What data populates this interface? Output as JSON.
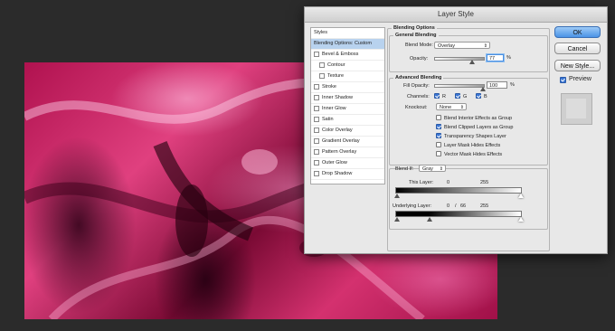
{
  "window": {
    "title": "Layer Style"
  },
  "styles_list": [
    {
      "label": "Styles",
      "checkbox": false,
      "selected": false,
      "sub": false
    },
    {
      "label": "Blending Options: Custom",
      "checkbox": false,
      "selected": true,
      "sub": false
    },
    {
      "label": "Bevel & Emboss",
      "checkbox": true,
      "selected": false,
      "sub": false
    },
    {
      "label": "Contour",
      "checkbox": true,
      "selected": false,
      "sub": true
    },
    {
      "label": "Texture",
      "checkbox": true,
      "selected": false,
      "sub": true
    },
    {
      "label": "Stroke",
      "checkbox": true,
      "selected": false,
      "sub": false
    },
    {
      "label": "Inner Shadow",
      "checkbox": true,
      "selected": false,
      "sub": false
    },
    {
      "label": "Inner Glow",
      "checkbox": true,
      "selected": false,
      "sub": false
    },
    {
      "label": "Satin",
      "checkbox": true,
      "selected": false,
      "sub": false
    },
    {
      "label": "Color Overlay",
      "checkbox": true,
      "selected": false,
      "sub": false
    },
    {
      "label": "Gradient Overlay",
      "checkbox": true,
      "selected": false,
      "sub": false
    },
    {
      "label": "Pattern Overlay",
      "checkbox": true,
      "selected": false,
      "sub": false
    },
    {
      "label": "Outer Glow",
      "checkbox": true,
      "selected": false,
      "sub": false
    },
    {
      "label": "Drop Shadow",
      "checkbox": true,
      "selected": false,
      "sub": false
    }
  ],
  "blending_options": {
    "title": "Blending Options",
    "general": {
      "title": "General Blending",
      "blend_mode_label": "Blend Mode:",
      "blend_mode_value": "Overlay",
      "opacity_label": "Opacity:",
      "opacity_value": "77",
      "opacity_unit": "%",
      "opacity_level": 0.77
    },
    "advanced": {
      "title": "Advanced Blending",
      "fill_opacity_label": "Fill Opacity:",
      "fill_opacity_value": "100",
      "fill_opacity_unit": "%",
      "fill_opacity_level": 1.0,
      "channels_label": "Channels:",
      "channels": [
        {
          "label": "R",
          "checked": true
        },
        {
          "label": "G",
          "checked": true
        },
        {
          "label": "B",
          "checked": true
        }
      ],
      "knockout_label": "Knockout:",
      "knockout_value": "None",
      "options": [
        {
          "label": "Blend Interior Effects as Group",
          "checked": false
        },
        {
          "label": "Blend Clipped Layers as Group",
          "checked": true
        },
        {
          "label": "Transparency Shapes Layer",
          "checked": true
        },
        {
          "label": "Layer Mask Hides Effects",
          "checked": false
        },
        {
          "label": "Vector Mask Hides Effects",
          "checked": false
        }
      ]
    },
    "blend_if": {
      "label": "Blend If:",
      "value": "Gray",
      "this_layer": {
        "label": "This Layer:",
        "low": "0",
        "high": "255"
      },
      "underlying_layer": {
        "label": "Underlying Layer:",
        "low": "0",
        "sep": "/",
        "mid": "66",
        "high": "255"
      }
    }
  },
  "buttons": {
    "ok": "OK",
    "cancel": "Cancel",
    "new_style": "New Style..."
  },
  "preview": {
    "label": "Preview",
    "checked": true
  },
  "colors": {
    "accent": "#3a76d4",
    "canvas_pink": "#d4316f"
  }
}
